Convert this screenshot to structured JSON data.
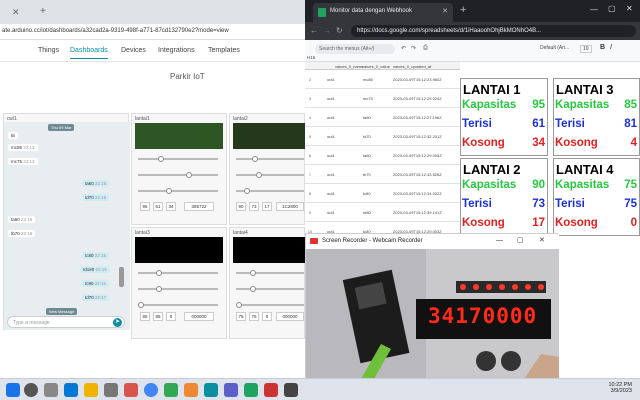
{
  "left_browser": {
    "url": "ate.arduino.cc/iot/dashboards/a32cad2a-9319-498f-a771-87cd132790e2?mode=view",
    "nav": [
      "Things",
      "Dashboards",
      "Devices",
      "Integrations",
      "Templates"
    ],
    "dashboard_title": "Parkir IoT",
    "chat": {
      "title": "out1",
      "date_pill": "Thu 09 Mar",
      "messages": [
        {
          "text": "tiii",
          "time": "",
          "side": "left"
        },
        {
          "text": "mc85",
          "time": "22:13",
          "side": "left"
        },
        {
          "text": "mc75",
          "time": "22:13",
          "side": "left"
        },
        {
          "text": "ta60",
          "time": "22:16",
          "side": "right"
        },
        {
          "text": "td70",
          "time": "22:16",
          "side": "right"
        },
        {
          "text": "ta60",
          "time": "22:16",
          "side": "left"
        },
        {
          "text": "tb70",
          "time": "22:16",
          "side": "left"
        },
        {
          "text": "tc80",
          "time": "22:15",
          "side": "right"
        },
        {
          "text": "td180",
          "time": "22:15",
          "side": "right"
        },
        {
          "text": "tc80",
          "time": "22:16",
          "side": "right"
        },
        {
          "text": "td70",
          "time": "22:17",
          "side": "right"
        }
      ],
      "new_message_pill": "New Message",
      "placeholder": "Type a message"
    },
    "widgets": [
      {
        "title": "lantai1",
        "values": [
          "95",
          "61",
          "34",
          "385722"
        ]
      },
      {
        "title": "lantai2",
        "values": [
          "90",
          "73",
          "17",
          "1C2800"
        ]
      },
      {
        "title": "lantai3",
        "values": [
          "85",
          "85",
          "0",
          "000000"
        ]
      },
      {
        "title": "lantai4",
        "values": [
          "75",
          "75",
          "0",
          "000000"
        ]
      }
    ]
  },
  "right_browser": {
    "tab_title": "Monitor data dengan Webhook",
    "url": "https://docs.google.com/spreadsheets/d/1iHaaoohOhjBkMONhO4B...",
    "search_placeholder": "Search the menus (Alt+/)",
    "cell_ref": "H16",
    "font_name": "Default (Ari...",
    "font_size": "10",
    "headers": [
      "values_0_name",
      "values_0_value",
      "values_0_updated_at"
    ],
    "rows": [
      {
        "n": "2",
        "name": "out1",
        "value": "mc85",
        "updated": "2023-03-09T15:12:23.960Z"
      },
      {
        "n": "3",
        "name": "out1",
        "value": "mc75",
        "updated": "2023-03-09T15:12:25.024Z"
      },
      {
        "n": "4",
        "name": "out1",
        "value": "ta60",
        "updated": "2023-03-09T15:12:27.196Z"
      },
      {
        "n": "5",
        "name": "out1",
        "value": "td70",
        "updated": "2023-03-09T15:12:32.201Z"
      },
      {
        "n": "6",
        "name": "out1",
        "value": "ta60",
        "updated": "2023-03-09T15:12:29.005Z"
      },
      {
        "n": "7",
        "name": "out1",
        "value": "tb70",
        "updated": "2023-03-09T15:12:33.526Z"
      },
      {
        "n": "8",
        "name": "out1",
        "value": "tc80",
        "updated": "2023-03-09T15:12:34.002Z"
      },
      {
        "n": "9",
        "name": "out1",
        "value": "td80",
        "updated": "2023-03-09T15:12:39.141Z"
      },
      {
        "n": "10",
        "name": "out1",
        "value": "tc80",
        "updated": "2023-03-09T15:12:29.003Z"
      },
      {
        "n": "11",
        "name": "out1",
        "value": "td70",
        "updated": "2023-03-09T15:12:39.006Z"
      }
    ],
    "panels": [
      {
        "title": "LANTAI 1",
        "kapasitas": "95",
        "terisi": "61",
        "kosong": "34"
      },
      {
        "title": "LANTAI 3",
        "kapasitas": "85",
        "terisi": "81",
        "kosong": "4"
      },
      {
        "title": "LANTAI 2",
        "kapasitas": "90",
        "terisi": "73",
        "kosong": "17"
      },
      {
        "title": "LANTAI 4",
        "kapasitas": "75",
        "terisi": "75",
        "kosong": "0"
      }
    ],
    "label_kapasitas": "Kapasitas",
    "label_terisi": "Terisi",
    "label_kosong": "Kosong"
  },
  "recorder": {
    "title": "Screen Recorder - Webcam Recorder",
    "display_digits": "34170000"
  },
  "taskbar": {
    "time": "10:22 PM",
    "date": "3/9/2023"
  },
  "colors": {
    "kapasitas": "#27c93f",
    "terisi": "#1a2fd6",
    "kosong": "#e02020",
    "led_red": "#ff2a1a"
  }
}
